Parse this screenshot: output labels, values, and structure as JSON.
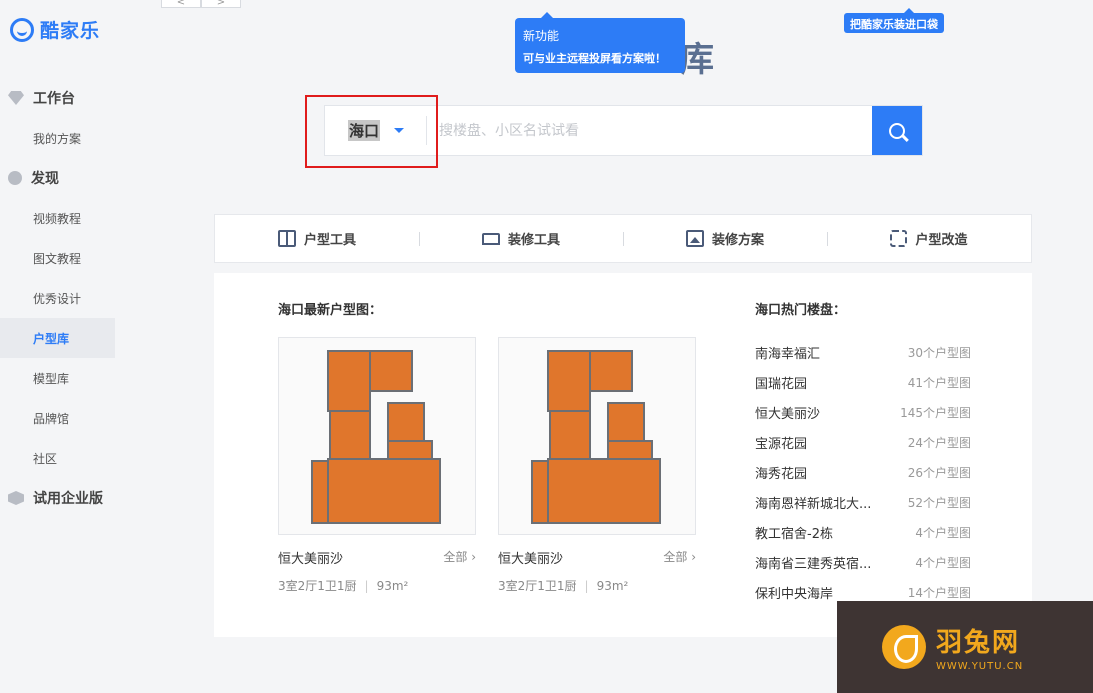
{
  "brand": {
    "name": "酷家乐"
  },
  "sidebar": {
    "groups": [
      {
        "label": "工作台",
        "items": [
          "我的方案"
        ]
      },
      {
        "label": "发现",
        "items": [
          "视频教程",
          "图文教程",
          "优秀设计",
          "户型库",
          "模型库",
          "品牌馆",
          "社区"
        ]
      },
      {
        "label": "试用企业版",
        "items": []
      }
    ],
    "active_item": "户型库"
  },
  "topbar": {
    "back": "<",
    "forward": ">"
  },
  "tooltips": {
    "new_feature_title": "新功能",
    "new_feature_desc": "可与业主远程投屏看方案啦！",
    "bag": "把酷家乐装进口袋"
  },
  "search": {
    "city": "海口",
    "placeholder": "搜楼盘、小区名试试看"
  },
  "tools": [
    {
      "label": "户型工具",
      "icon": "floorplan-tool-icon"
    },
    {
      "label": "装修工具",
      "icon": "brush-icon"
    },
    {
      "label": "装修方案",
      "icon": "picture-icon"
    },
    {
      "label": "户型改造",
      "icon": "wrench-icon"
    }
  ],
  "latest": {
    "title": "海口最新户型图：",
    "cards": [
      {
        "name": "恒大美丽沙",
        "all": "全部",
        "rooms": "3室2厅1卫1厨",
        "area": "93m²"
      },
      {
        "name": "恒大美丽沙",
        "all": "全部",
        "rooms": "3室2厅1卫1厨",
        "area": "93m²"
      }
    ]
  },
  "hot": {
    "title": "海口热门楼盘：",
    "items": [
      {
        "name": "南海幸福汇",
        "count": "30个户型图"
      },
      {
        "name": "国瑞花园",
        "count": "41个户型图"
      },
      {
        "name": "恒大美丽沙",
        "count": "145个户型图"
      },
      {
        "name": "宝源花园",
        "count": "24个户型图"
      },
      {
        "name": "海秀花园",
        "count": "26个户型图"
      },
      {
        "name": "海南恩祥新城北大...",
        "count": "52个户型图"
      },
      {
        "name": "教工宿舍-2栋",
        "count": "4个户型图"
      },
      {
        "name": "海南省三建秀英宿...",
        "count": "4个户型图"
      },
      {
        "name": "保利中央海岸",
        "count": "14个户型图"
      }
    ]
  },
  "watermark": {
    "name": "羽兔网",
    "url": "WWW.YUTU.CN"
  }
}
